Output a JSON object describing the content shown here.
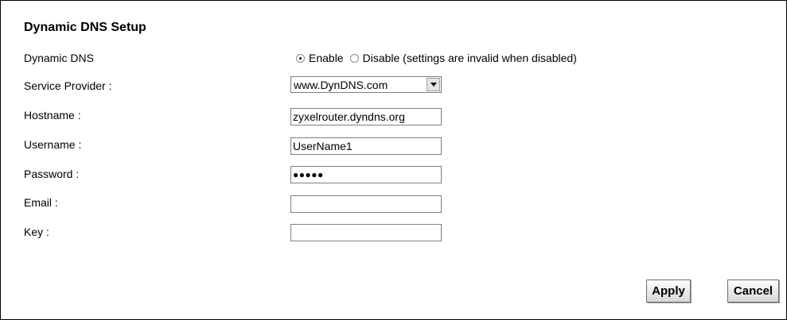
{
  "section_title": "Dynamic DNS Setup",
  "fields": {
    "dynamic_dns": {
      "label": "Dynamic DNS",
      "enable_label": "Enable",
      "disable_label": "Disable (settings are invalid when disabled)",
      "selected": "Enable"
    },
    "service_provider": {
      "label": "Service Provider :",
      "value": "www.DynDNS.com"
    },
    "hostname": {
      "label": "Hostname :",
      "value": "zyxelrouter.dyndns.org"
    },
    "username": {
      "label": "Username :",
      "value": "UserName1"
    },
    "password": {
      "label": "Password :",
      "value": "●●●●●"
    },
    "email": {
      "label": "Email :",
      "value": ""
    },
    "key": {
      "label": "Key :",
      "value": ""
    }
  },
  "buttons": {
    "apply": "Apply",
    "cancel": "Cancel"
  },
  "colors": {
    "border": "#000000",
    "input_border": "#7f7f7f",
    "button_top": "#ffffff",
    "button_bottom": "#d6d6d6"
  }
}
